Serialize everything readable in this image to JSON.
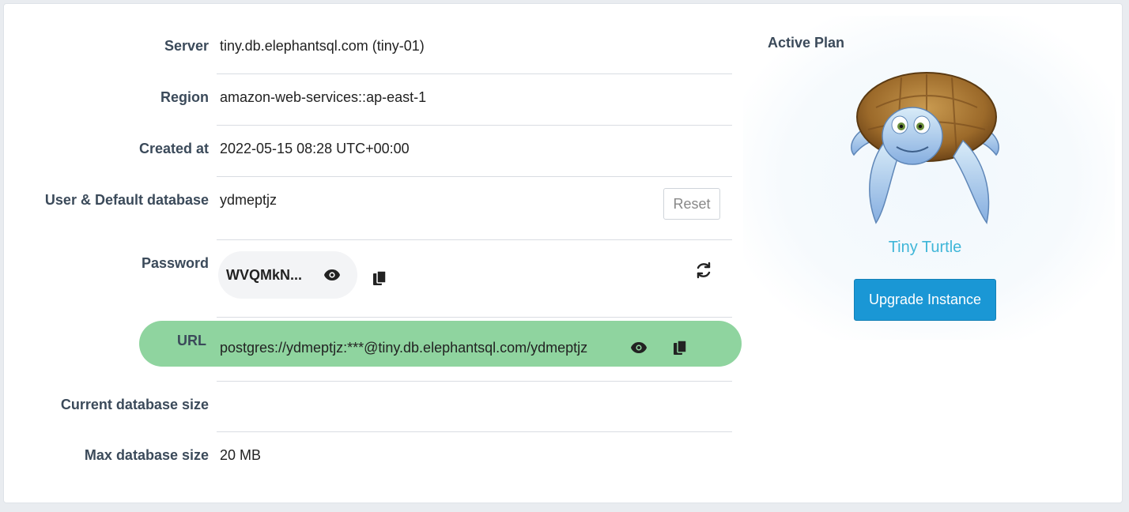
{
  "details": {
    "server": {
      "label": "Server",
      "value": "tiny.db.elephantsql.com (tiny-01)"
    },
    "region": {
      "label": "Region",
      "value": "amazon-web-services::ap-east-1"
    },
    "created": {
      "label": "Created at",
      "value": "2022-05-15 08:28 UTC+00:00"
    },
    "user": {
      "label": "User & Default database",
      "value": "ydmeptjz",
      "reset_label": "Reset"
    },
    "password": {
      "label": "Password",
      "value": "WVQMkN..."
    },
    "url": {
      "label": "URL",
      "value": "postgres://ydmeptjz:***@tiny.db.elephantsql.com/ydmeptjz"
    },
    "current_size": {
      "label": "Current database size",
      "value": ""
    },
    "max_size": {
      "label": "Max database size",
      "value": "20 MB"
    }
  },
  "plan": {
    "title": "Active Plan",
    "name": "Tiny Turtle",
    "upgrade_label": "Upgrade Instance"
  },
  "colors": {
    "accent": "#1a97d5",
    "url_highlight": "#8fd49f",
    "plan_name": "#3fb6d8"
  },
  "icons": [
    "eye-icon",
    "copy-icon",
    "refresh-icon",
    "turtle-mascot"
  ]
}
